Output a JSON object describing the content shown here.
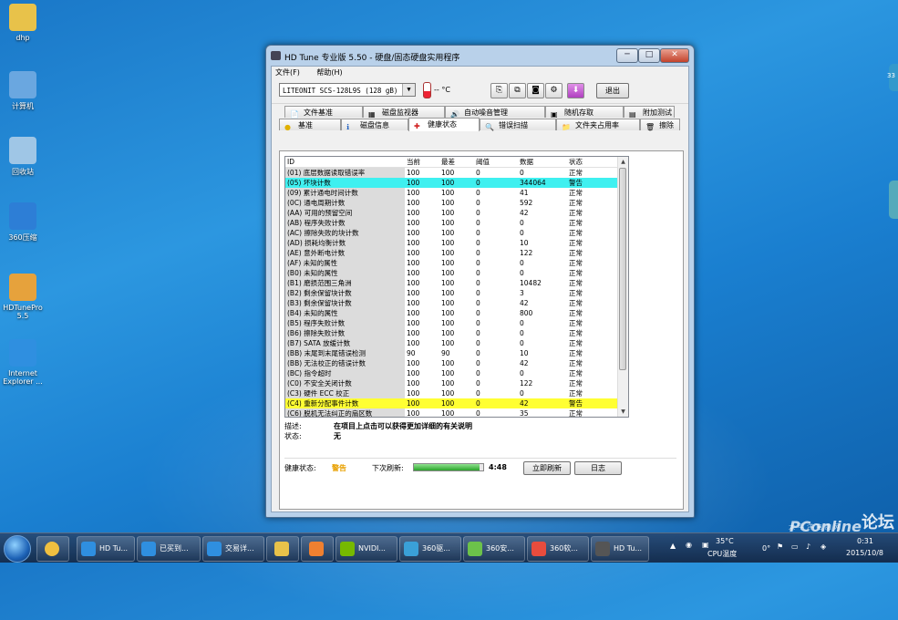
{
  "desktop": {
    "icons": [
      {
        "label": "dhp",
        "color": "#e8c24a"
      },
      {
        "label": "计算机",
        "color": "#6aa7e0"
      },
      {
        "label": "回收站",
        "color": "#9fc6e6"
      },
      {
        "label": "360压缩",
        "color": "#2d7ed6"
      },
      {
        "label": "HDTunePro 5.5",
        "color": "#e6a23c"
      },
      {
        "label": "Internet Explorer ...",
        "color": "#2f8fe0"
      }
    ],
    "gadget_label": "33"
  },
  "window": {
    "title": "HD Tune 专业版 5.50 - 硬盘/固态硬盘实用程序",
    "minimize": "─",
    "maximize": "□",
    "close": "✕",
    "menu": [
      "文件(F)",
      "帮助(H)"
    ],
    "drive_select": "LITEONIT SCS-128L9S     (128 gB)",
    "temperature": "-- °C",
    "exit_label": "退出",
    "tabs_top": [
      {
        "label": "文件基准",
        "icon": "📄"
      },
      {
        "label": "磁盘监视器",
        "icon": "▦"
      },
      {
        "label": "自动噪音管理",
        "icon": "🔊"
      },
      {
        "label": "随机存取",
        "icon": "▣"
      },
      {
        "label": "附加测试",
        "icon": "▤"
      }
    ],
    "tabs_bottom": [
      {
        "label": "基准",
        "icon": "●"
      },
      {
        "label": "磁盘信息",
        "icon": "ℹ"
      },
      {
        "label": "健康状态",
        "icon": "✚"
      },
      {
        "label": "错误扫描",
        "icon": "🔍"
      },
      {
        "label": "文件夹占用率",
        "icon": "📁"
      },
      {
        "label": "擦除",
        "icon": "🗑"
      }
    ],
    "columns": [
      "ID",
      "当前",
      "最差",
      "阈值",
      "数据",
      "状态"
    ],
    "rows": [
      [
        "(01) 底层数据读取错误率",
        "100",
        "100",
        "0",
        "0",
        "正常"
      ],
      [
        "(05) 坏块计数",
        "100",
        "100",
        "0",
        "344064",
        "警告"
      ],
      [
        "(09) 累计通电时间计数",
        "100",
        "100",
        "0",
        "41",
        "正常"
      ],
      [
        "(0C) 通电周期计数",
        "100",
        "100",
        "0",
        "592",
        "正常"
      ],
      [
        "(AA) 可用的预留空间",
        "100",
        "100",
        "0",
        "42",
        "正常"
      ],
      [
        "(AB) 程序失败计数",
        "100",
        "100",
        "0",
        "0",
        "正常"
      ],
      [
        "(AC) 擦除失败的块计数",
        "100",
        "100",
        "0",
        "0",
        "正常"
      ],
      [
        "(AD) 损耗均衡计数",
        "100",
        "100",
        "0",
        "10",
        "正常"
      ],
      [
        "(AE) 意外断电计数",
        "100",
        "100",
        "0",
        "122",
        "正常"
      ],
      [
        "(AF) 未知的属性",
        "100",
        "100",
        "0",
        "0",
        "正常"
      ],
      [
        "(B0) 未知的属性",
        "100",
        "100",
        "0",
        "0",
        "正常"
      ],
      [
        "(B1) 磨损范围三角洲",
        "100",
        "100",
        "0",
        "10482",
        "正常"
      ],
      [
        "(B2) 剩余保留块计数",
        "100",
        "100",
        "0",
        "3",
        "正常"
      ],
      [
        "(B3) 剩余保留块计数",
        "100",
        "100",
        "0",
        "42",
        "正常"
      ],
      [
        "(B4) 未知的属性",
        "100",
        "100",
        "0",
        "800",
        "正常"
      ],
      [
        "(B5) 程序失败计数",
        "100",
        "100",
        "0",
        "0",
        "正常"
      ],
      [
        "(B6) 擦除失败计数",
        "100",
        "100",
        "0",
        "0",
        "正常"
      ],
      [
        "(B7) SATA 放缓计数",
        "100",
        "100",
        "0",
        "0",
        "正常"
      ],
      [
        "(BB) 末尾到末尾错误检测",
        "90",
        "90",
        "0",
        "10",
        "正常"
      ],
      [
        "(BB) 无法校正的错误计数",
        "100",
        "100",
        "0",
        "42",
        "正常"
      ],
      [
        "(BC) 指令超时",
        "100",
        "100",
        "0",
        "0",
        "正常"
      ],
      [
        "(C0) 不安全关闭计数",
        "100",
        "100",
        "0",
        "122",
        "正常"
      ],
      [
        "(C3) 硬件 ECC 校正",
        "100",
        "100",
        "0",
        "0",
        "正常"
      ],
      [
        "(C4) 重新分配事件计数",
        "100",
        "100",
        "0",
        "42",
        "警告"
      ],
      [
        "(C6) 脱机无法纠正的扇区数",
        "100",
        "100",
        "0",
        "35",
        "正常"
      ],
      [
        "(C7) CRC 接口错误计数",
        "100",
        "100",
        "0",
        "0",
        "正常"
      ]
    ],
    "highlight_cyan": "#3ff0f0",
    "highlight_yellow": "#ffff33",
    "description_label": "描述:",
    "description_value": "在项目上点击可以获得更加详细的有关说明",
    "status_label": "状态:",
    "status_value": "无",
    "health_label": "健康状态:",
    "health_value": "警告",
    "health_color": "#e8a000",
    "next_refresh_label": "下次刷新:",
    "refresh_progress": 0.95,
    "refresh_time": "4:48",
    "refresh_button": "立即刷新",
    "log_button": "日志"
  },
  "taskbar": {
    "tasks": [
      {
        "label": "HD Tu...",
        "color": "#2f8fe0"
      },
      {
        "label": "已买到...",
        "color": "#2f8fe0"
      },
      {
        "label": "交易详...",
        "color": "#2f8fe0"
      },
      {
        "label": "",
        "color": "#e8c24a"
      },
      {
        "label": "",
        "color": "#f08030"
      },
      {
        "label": "NVIDI...",
        "color": "#76b900"
      },
      {
        "label": "360驱...",
        "color": "#3aa0d8"
      },
      {
        "label": "360安...",
        "color": "#6cc24a"
      },
      {
        "label": "360软...",
        "color": "#e84c3d"
      },
      {
        "label": "HD Tu...",
        "color": "#555555"
      }
    ],
    "cpu_temp": "35°C",
    "cpu_label": "CPU温度",
    "time": "0:31",
    "date": "2015/10/8",
    "watermark": "PConline",
    "watermark_sub": "太平洋电脑网",
    "watermark_forum": "论坛"
  }
}
